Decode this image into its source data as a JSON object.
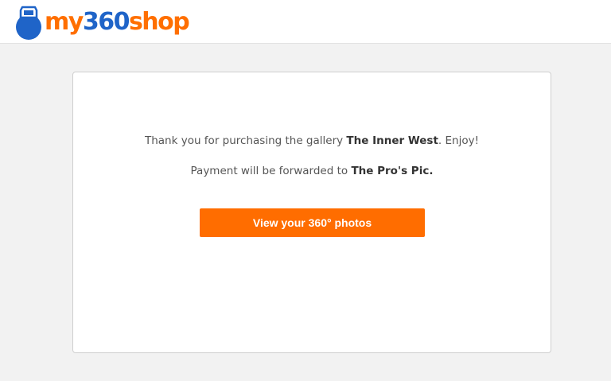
{
  "header": {
    "logo": {
      "text_prefix": "my",
      "text_number": "360",
      "text_suffix": "shop",
      "icon": "camera-drone-logo-icon"
    }
  },
  "confirmation": {
    "line1_prefix": "Thank you for purchasing the gallery ",
    "gallery_name": "The Inner West",
    "line1_suffix": ". Enjoy!",
    "line2_prefix": "Payment will be forwarded to ",
    "payee_name": "The Pro's Pic.",
    "view_button_label": "View your 360° photos"
  },
  "colors": {
    "brand_orange": "#ff6f00",
    "brand_blue": "#1f64c8",
    "button_bg": "#ff6d00",
    "page_bg": "#f2f2f2"
  }
}
